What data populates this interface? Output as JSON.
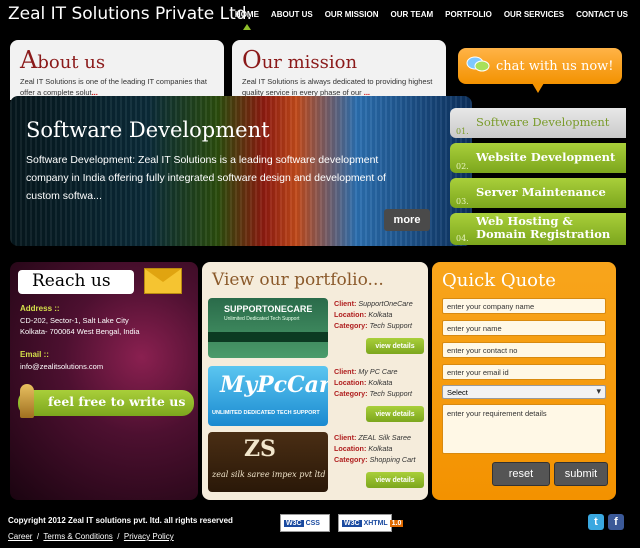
{
  "header": {
    "brand": "Zeal IT Solutions Private Ltd.",
    "nav": [
      "HOME",
      "ABOUT US",
      "OUR MISSION",
      "OUR TEAM",
      "PORTFOLIO",
      "OUR SERVICES",
      "CONTACT US"
    ],
    "active": "HOME"
  },
  "about": {
    "title_first": "A",
    "title_rest": "bout us",
    "text": "Zeal IT Solutions is one of the leading IT companies that offer a complete solut",
    "more": "..."
  },
  "mission": {
    "title_first": "O",
    "title_rest": "ur mission",
    "text": "Zeal IT Solutions is always dedicated to providing highest quality service in every phase of our",
    "more": "..."
  },
  "chat": {
    "label": "chat with us now!"
  },
  "hero": {
    "title": "Software Development",
    "text": "Software Development:   Zeal IT Solutions is a leading software development company in India offering fully integrated software design and development of custom softwa...",
    "more": "more"
  },
  "services": [
    {
      "num": "01.",
      "label": "Software Development"
    },
    {
      "num": "02.",
      "label": "Website Development"
    },
    {
      "num": "03.",
      "label": "Server Maintenance"
    },
    {
      "num": "04.",
      "label_line1": "Web Hosting &",
      "label_line2": "Domain Registration"
    }
  ],
  "reach": {
    "title": "Reach us",
    "address_label": "Address ::",
    "address_line1": "CD-202, Sector-1, Salt Lake City",
    "address_line2": "Kolkata- 700064 West Bengal, India",
    "email_label": "Email ::",
    "email": "info@zealitsolutions.com",
    "write": "feel free to write us"
  },
  "portfolio": {
    "title": "View our portfolio...",
    "labels": {
      "client": "Client:",
      "location": "Location:",
      "category": "Category:"
    },
    "view_details": "view details",
    "items": [
      {
        "thumb_title": "SUPPORTONECARE",
        "thumb_sub": "Unlimited Dedicated Tech Support",
        "client": "SupportOneCare",
        "location": "Kolkata",
        "category": "Tech Support"
      },
      {
        "thumb_title": "MyPcCare",
        "thumb_sub": "UNLIMITED DEDICATED TECH SUPPORT",
        "client": "My PC Care",
        "location": "Kolkata",
        "category": "Tech Support"
      },
      {
        "thumb_title": "ZS",
        "thumb_sub": "zeal silk saree impex pvt ltd",
        "client": "ZEAL Silk Saree",
        "location": "Kolkata",
        "category": "Shopping Cart"
      }
    ]
  },
  "quote": {
    "title": "Quick Quote",
    "company": "enter your company name",
    "name": "enter your name",
    "contact": "enter your contact no",
    "email": "enter your email id",
    "select": "Select",
    "requirement": "enter your requirement details",
    "reset": "reset",
    "submit": "submit"
  },
  "footer": {
    "copyright": "Copyright 2012 Zeal IT solutions pvt. ltd. all rights reserved",
    "links": [
      "Career",
      "Terms & Conditions",
      "Privacy Policy"
    ],
    "css_badge": "CSS",
    "xhtml_badge": "XHTML",
    "xhtml_version": "1.0",
    "w3c": "W3C"
  },
  "colors": {
    "accent_green": "#8fbf2a",
    "orange": "#f39200",
    "title_red": "#8b1a1a"
  }
}
